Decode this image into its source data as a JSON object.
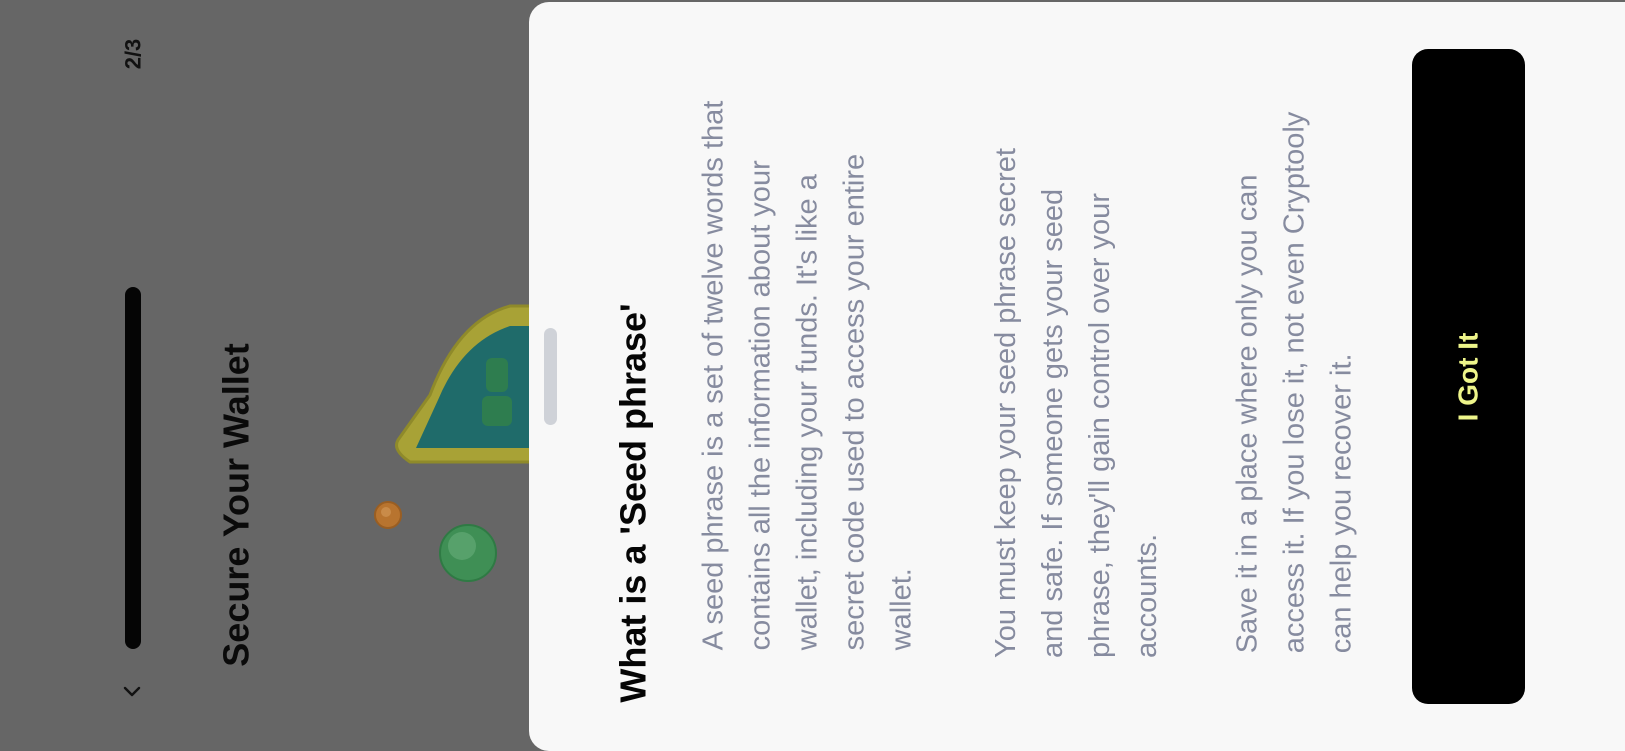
{
  "onboarding": {
    "step_counter": "2/3",
    "progress": 0.6667,
    "title": "Secure Your Wallet",
    "back_icon": "chevron-left-icon",
    "illustration": "shield-with-coins-illustration"
  },
  "sheet": {
    "title": "What is a 'Seed phrase'",
    "paragraph_1": [
      "A seed phrase is a set of twelve words that",
      "contains all the information about your",
      "wallet, including your funds. It's like a",
      "secret code used to access your entire",
      "wallet."
    ],
    "paragraph_2": [
      "You must keep your seed phrase secret",
      "and safe. If someone gets your seed",
      "phrase, they'll gain control over your",
      "accounts."
    ],
    "paragraph_3": [
      "Save it in a place where only you can",
      "access it. If you lose it, not even Cryptooly",
      "can help you recover it."
    ],
    "button_label": "I Got It"
  },
  "colors": {
    "overlay": "#666666",
    "sheet_background": "#f8f8f8",
    "body_text": "#868b9f",
    "button_background": "#000000",
    "button_text": "#eef58a",
    "handle": "#cfd2d8"
  }
}
